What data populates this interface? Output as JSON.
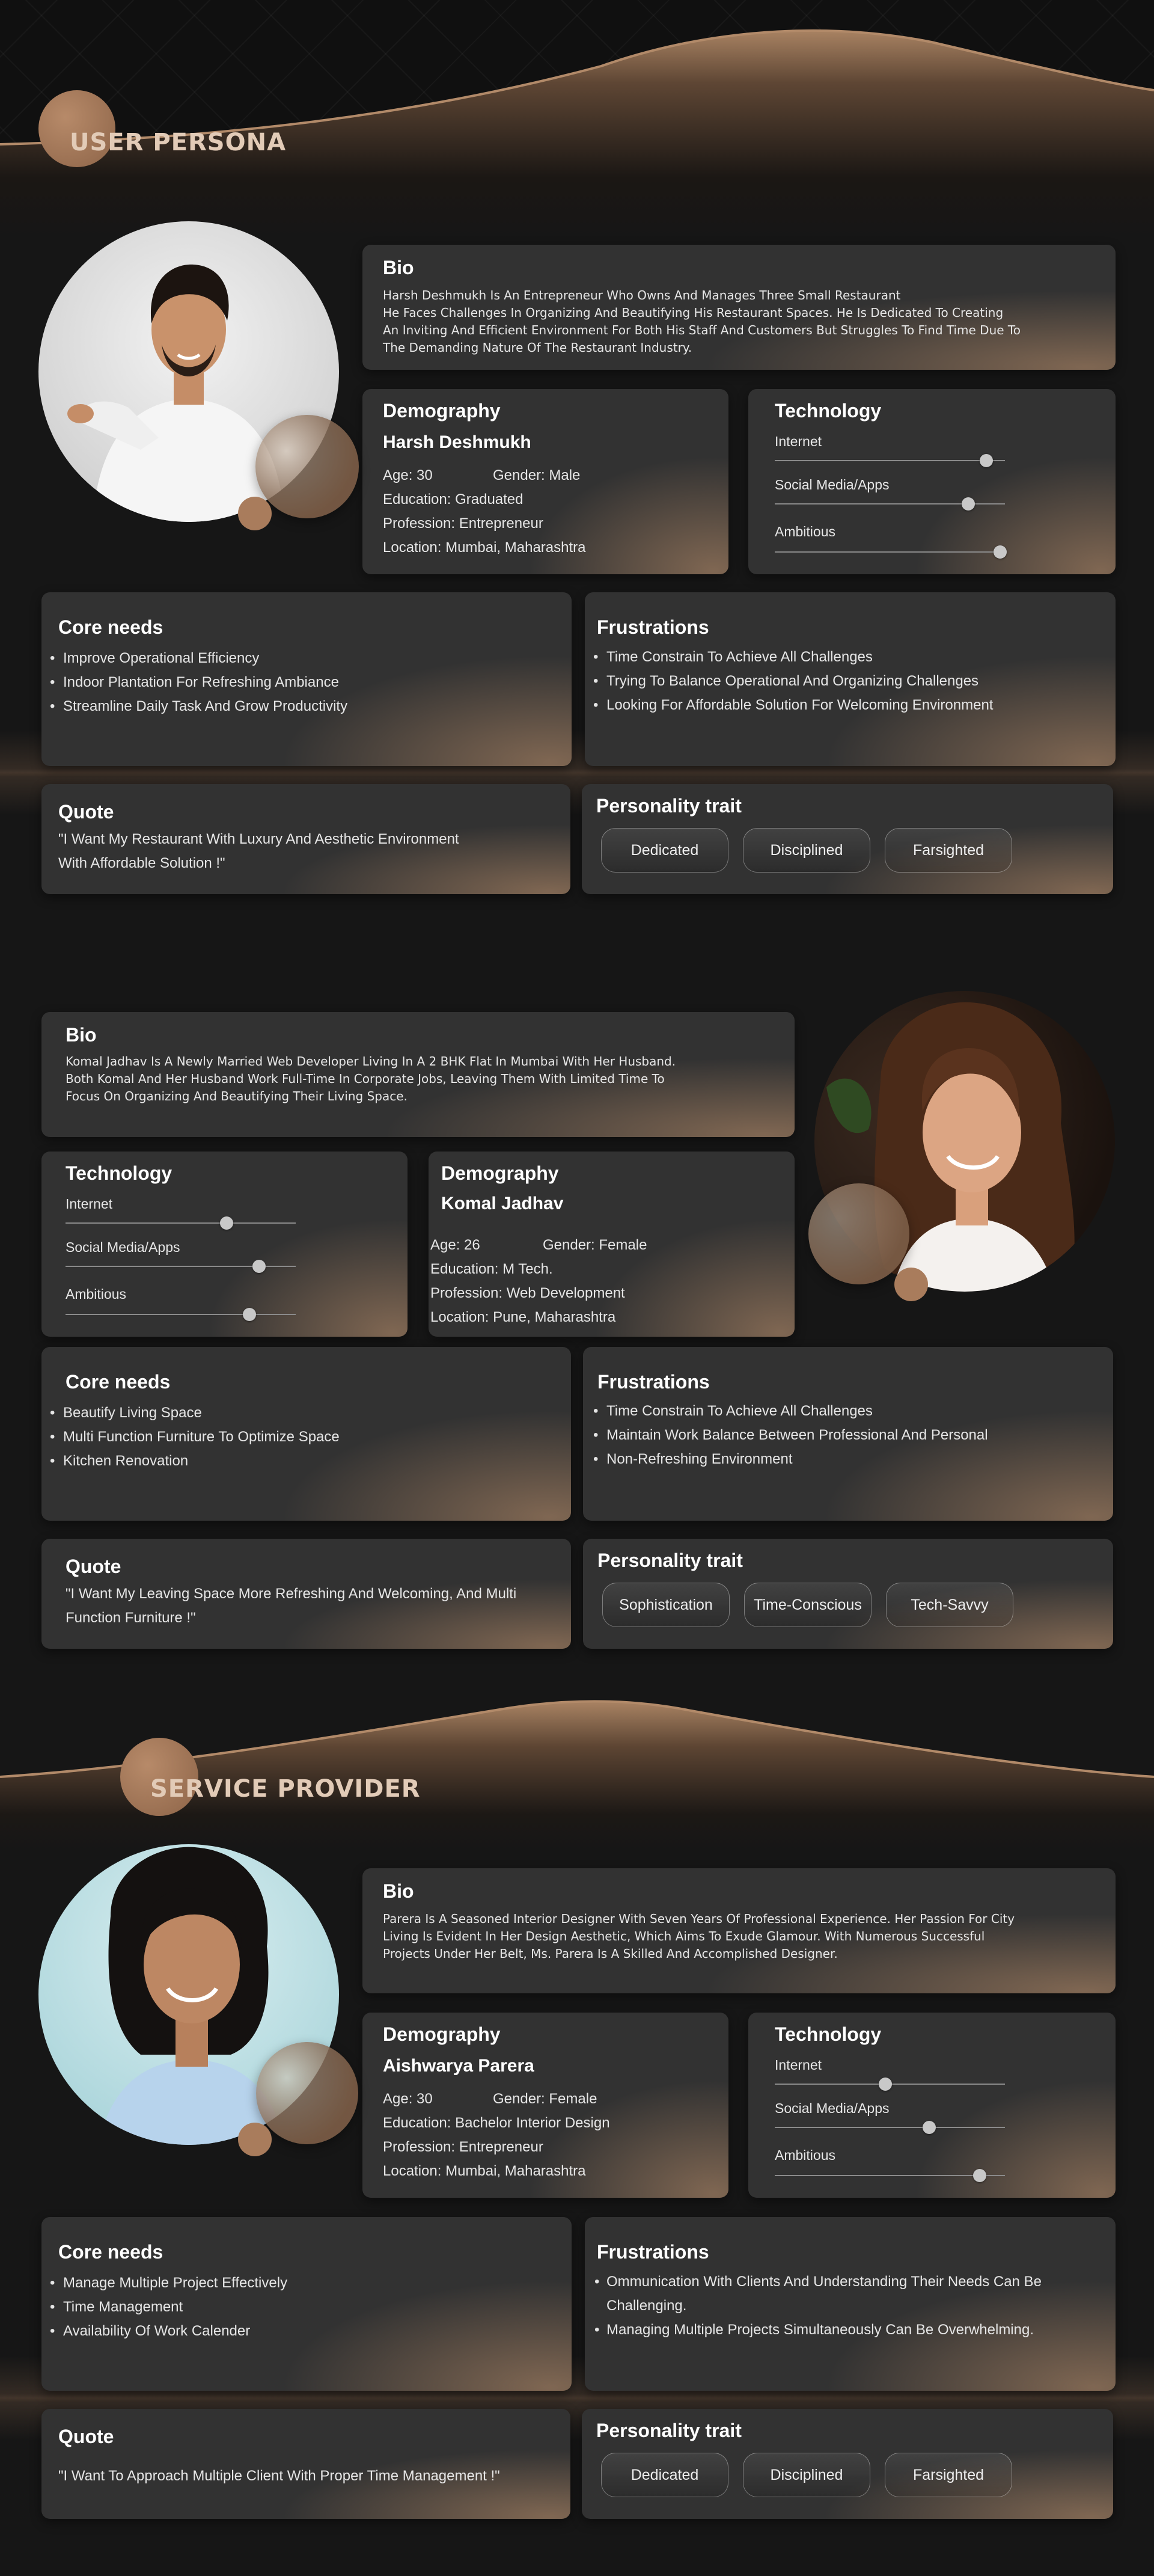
{
  "colors": {
    "background": "#161616",
    "card": "#323232",
    "accent": "#a97c5c",
    "title": "#e2cbb7"
  },
  "sections": {
    "user_persona": "USER PERSONA",
    "service_provider": "SERVICE PROVIDER"
  },
  "labels": {
    "bio": "Bio",
    "demography": "Demography",
    "technology": "Technology",
    "core_needs": "Core needs",
    "frustrations": "Frustrations",
    "quote": "Quote",
    "personality": "Personality trait",
    "internet": "Internet",
    "social": "Social Media/Apps",
    "ambitious": "Ambitious"
  },
  "personas": [
    {
      "photo_icon": "man-pointing-portrait",
      "bio": [
        "Harsh Deshmukh Is An Entrepreneur  Who Owns And Manages Three Small Restaurant",
        "He Faces Challenges In Organizing And Beautifying His Restaurant Spaces. He Is Dedicated To Creating",
        "An Inviting And Efficient Environment For Both His Staff And Customers But Struggles To Find Time Due To",
        "The Demanding Nature Of The Restaurant Industry."
      ],
      "name": "Harsh Deshmukh",
      "age": "Age: 30",
      "gender": "Gender:  Male",
      "education": "Education: Graduated",
      "profession": "Profession: Entrepreneur",
      "location": "Location: Mumbai, Maharashtra",
      "tech": {
        "internet": 0.92,
        "social": 0.84,
        "ambitious": 0.98
      },
      "core_needs": [
        "Improve Operational Efficiency",
        "Indoor Plantation For Refreshing Ambiance",
        "Streamline Daily Task And Grow Productivity"
      ],
      "frustrations": [
        "Time Constrain To Achieve All Challenges",
        "Trying To Balance Operational And Organizing Challenges",
        "Looking For Affordable Solution For Welcoming Environment"
      ],
      "quote": [
        "\"I Want My Restaurant With Luxury And Aesthetic Environment",
        "With Affordable Solution !\""
      ],
      "traits": [
        "Dedicated",
        "Disciplined",
        "Farsighted"
      ]
    },
    {
      "photo_icon": "woman-smiling-portrait",
      "bio": [
        "Komal Jadhav Is A Newly Married Web Developer Living In A 2 BHK Flat In Mumbai With Her Husband.",
        "Both Komal And Her Husband Work Full-Time In Corporate Jobs, Leaving Them With Limited Time To",
        "Focus On Organizing And Beautifying Their Living Space."
      ],
      "name": "Komal Jadhav",
      "age": "Age: 26",
      "gender": "Gender:  Female",
      "education": "Education: M Tech.",
      "profession": "Profession: Web Development",
      "location": "Location: Pune, Maharashtra",
      "tech": {
        "internet": 0.7,
        "social": 0.84,
        "ambitious": 0.8
      },
      "core_needs": [
        "Beautify Living Space",
        "Multi Function Furniture To Optimize Space",
        "Kitchen Renovation"
      ],
      "frustrations": [
        "Time Constrain To Achieve All Challenges",
        "Maintain Work Balance Between Professional And Personal",
        "Non-Refreshing Environment"
      ],
      "quote": [
        "\"I Want My Leaving Space More Refreshing And Welcoming, And Multi",
        "Function Furniture  !\""
      ],
      "traits": [
        "Sophistication",
        "Time-Conscious",
        "Tech-Savvy"
      ]
    },
    {
      "photo_icon": "woman-designer-portrait",
      "bio": [
        "Parera Is A Seasoned Interior Designer With Seven Years Of Professional Experience. Her Passion For City",
        "Living Is Evident In Her Design Aesthetic, Which Aims To Exude Glamour. With Numerous Successful",
        "Projects Under Her Belt, Ms. Parera Is A Skilled And Accomplished Designer."
      ],
      "name": "Aishwarya Parera",
      "age": "Age: 30",
      "gender": "Gender: Female",
      "education": "Education: Bachelor Interior Design",
      "profession": "Profession: Entrepreneur",
      "location": "Location: Mumbai, Maharashtra",
      "tech": {
        "internet": 0.48,
        "social": 0.67,
        "ambitious": 0.89
      },
      "core_needs": [
        "Manage Multiple Project Effectively",
        "Time Management",
        "Availability Of Work Calender"
      ],
      "frustrations": [
        "Ommunication With Clients And Understanding Their Needs Can Be Challenging.",
        "Managing Multiple Projects Simultaneously Can Be Overwhelming."
      ],
      "quote": [
        "\"I Want To Approach Multiple Client With Proper Time Management  !\""
      ],
      "traits": [
        "Dedicated",
        "Disciplined",
        "Farsighted"
      ]
    }
  ]
}
